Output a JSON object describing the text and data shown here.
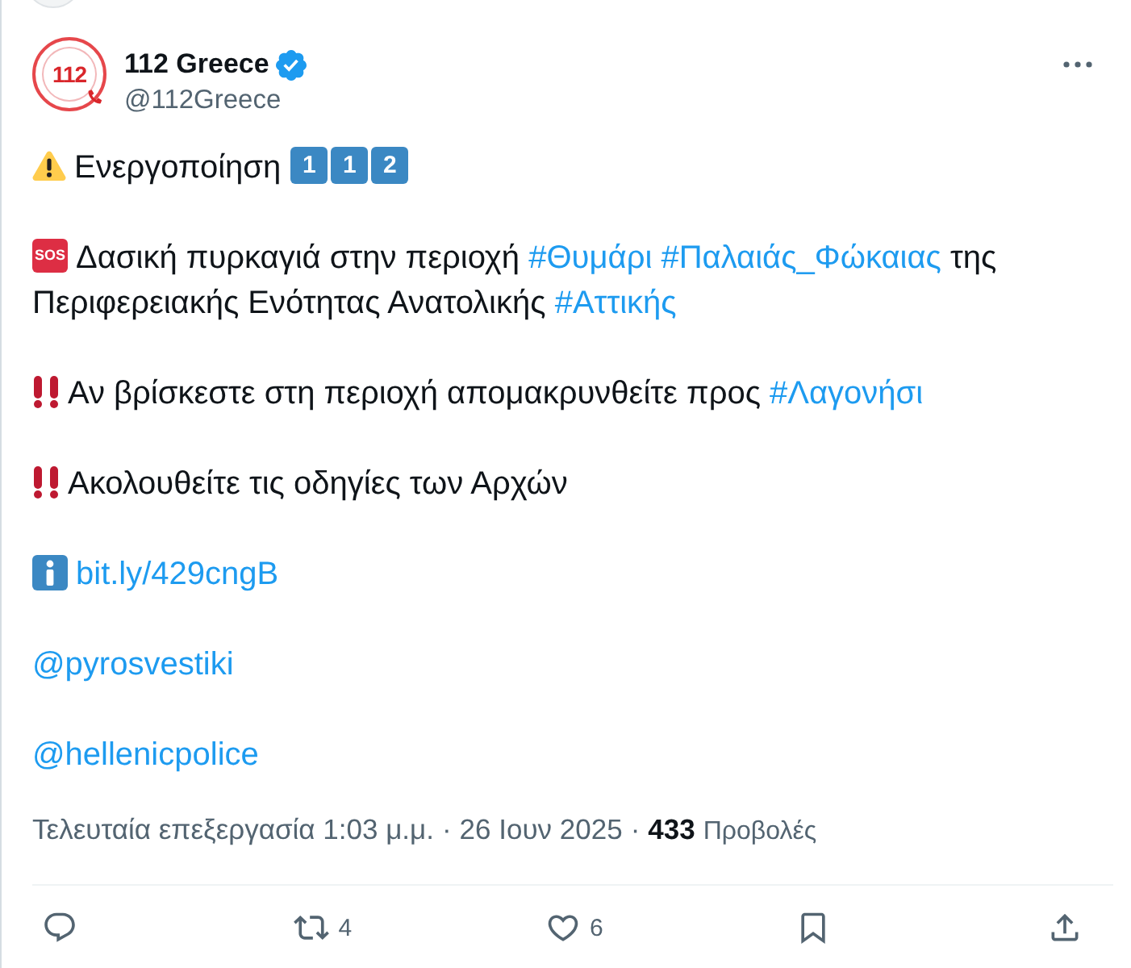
{
  "author": {
    "avatar_text": "112",
    "name": "112 Greece",
    "handle": "@112Greece"
  },
  "post": {
    "paragraphs": [
      {
        "kind": "warning",
        "segments": [
          {
            "kind": "text",
            "text": "Ενεργοποίηση"
          }
        ],
        "keycaps": [
          "1",
          "1",
          "2"
        ]
      },
      {
        "kind": "sos",
        "emoji_text": "SOS",
        "segments": [
          {
            "kind": "text",
            "text": "Δασική πυρκαγιά στην περιοχή"
          },
          {
            "kind": "hashtag",
            "text": "#Θυμάρι"
          },
          {
            "kind": "hashtag",
            "text": "#Παλαιάς_Φώκαιας"
          },
          {
            "kind": "text",
            "text": "της Περιφερειακής Ενότητας Ανατολικής"
          },
          {
            "kind": "hashtag",
            "text": "#Αττικής"
          }
        ]
      },
      {
        "kind": "alert",
        "segments": [
          {
            "kind": "text",
            "text": "Αν βρίσκεστε στη περιοχή απομακρυνθείτε προς"
          },
          {
            "kind": "hashtag",
            "text": "#Λαγονήσι"
          }
        ]
      },
      {
        "kind": "alert",
        "segments": [
          {
            "kind": "text",
            "text": "Ακολουθείτε τις οδηγίες των Αρχών"
          }
        ]
      },
      {
        "kind": "info",
        "segments": [
          {
            "kind": "url",
            "text": "bit.ly/429cngB"
          }
        ]
      },
      {
        "kind": "plain",
        "segments": [
          {
            "kind": "mention",
            "text": "@pyrosvestiki"
          }
        ]
      },
      {
        "kind": "plain",
        "segments": [
          {
            "kind": "mention",
            "text": "@hellenicpolice"
          }
        ]
      }
    ]
  },
  "meta": [
    {
      "kind": "time",
      "text": "Τελευταία επεξεργασία 1:03 μ.μ."
    },
    {
      "kind": "separator",
      "text": "·"
    },
    {
      "kind": "date",
      "text": "26 Ιουν 2025"
    },
    {
      "kind": "separator",
      "text": "·"
    },
    {
      "kind": "count",
      "text": "433"
    },
    {
      "kind": "label",
      "text": "Προβολές"
    }
  ],
  "actions": [
    {
      "kind": "reply"
    },
    {
      "kind": "repost",
      "count": "4"
    },
    {
      "kind": "like",
      "count": "6"
    },
    {
      "kind": "bookmark"
    },
    {
      "kind": "share"
    }
  ]
}
